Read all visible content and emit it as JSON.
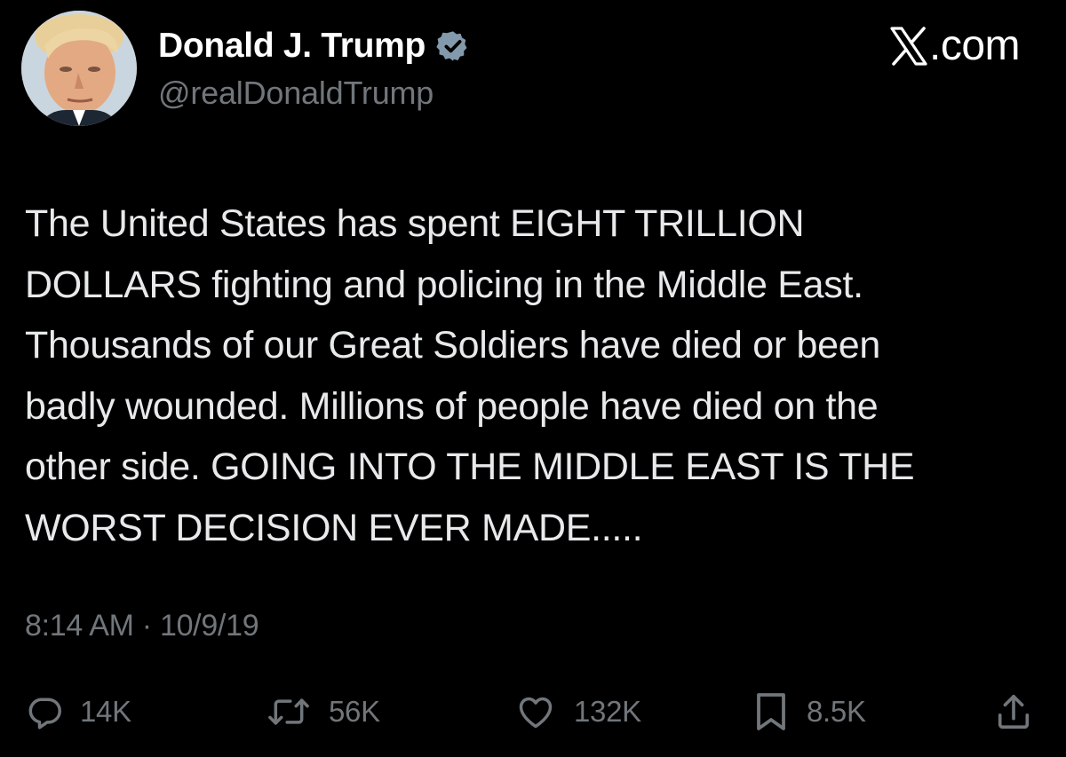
{
  "author": {
    "display_name": "Donald J. Trump",
    "handle": "@realDonaldTrump",
    "verified": true,
    "avatar": "profile-photo"
  },
  "brand": {
    "label": ".com",
    "icon": "x-logo-icon"
  },
  "tweet": {
    "lines": [
      "The United States has spent EIGHT TRILLION",
      "DOLLARS fighting and policing in the Middle East.",
      "Thousands of our Great Soldiers have died or been",
      "badly wounded. Millions of people have died on the",
      "other side. GOING INTO THE MIDDLE EAST IS THE",
      "WORST DECISION EVER MADE....."
    ],
    "timestamp": "8:14 AM · 10/9/19"
  },
  "actions": {
    "reply": {
      "icon": "reply-icon",
      "count": "14K"
    },
    "repost": {
      "icon": "repost-icon",
      "count": "56K"
    },
    "like": {
      "icon": "heart-icon",
      "count": "132K"
    },
    "bookmark": {
      "icon": "bookmark-icon",
      "count": "8.5K"
    },
    "share": {
      "icon": "share-icon"
    }
  },
  "colors": {
    "background": "#000000",
    "text": "#e7e9ea",
    "secondary": "#71767b",
    "verified_badge": "#829aab"
  }
}
